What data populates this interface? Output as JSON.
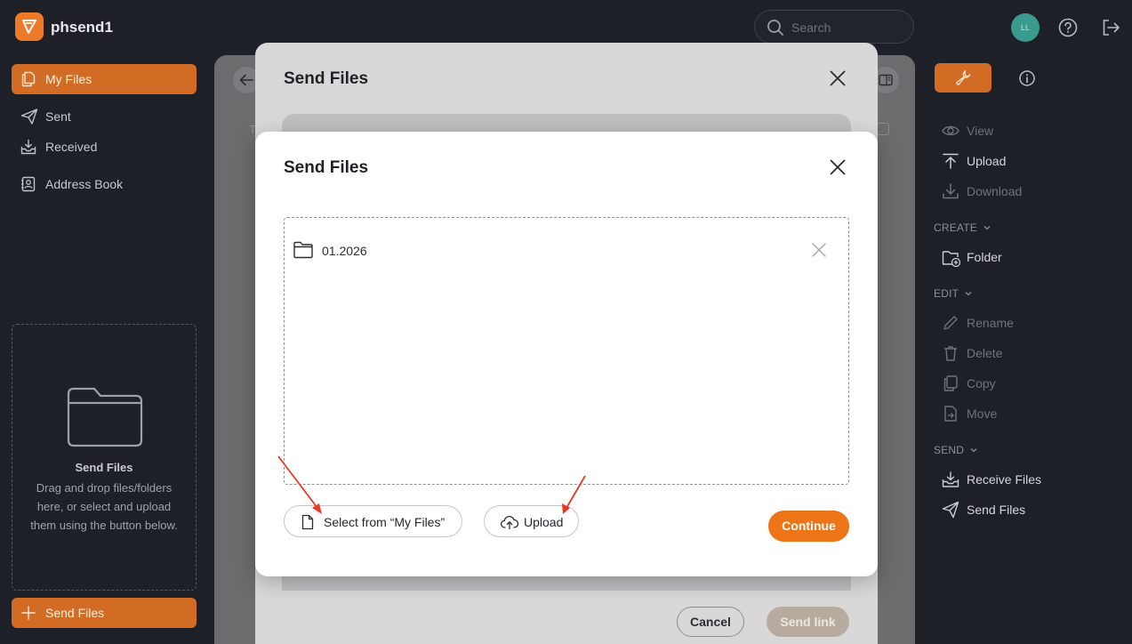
{
  "app": {
    "org_name": "phsend1",
    "avatar_initials": "LL",
    "accent_color": "#ed7417"
  },
  "search": {
    "placeholder": "Search"
  },
  "sidebar": {
    "items": [
      {
        "label": "My Files",
        "icon": "files-icon",
        "active": true
      },
      {
        "label": "Sent",
        "icon": "paper-plane-icon"
      },
      {
        "label": "Received",
        "icon": "inbox-download-icon"
      },
      {
        "label": "Address Book",
        "icon": "address-book-icon"
      }
    ],
    "dropzone": {
      "title": "Send Files",
      "text": "Drag and drop files/folders here, or select and upload them using the button below."
    },
    "send_button": "Send Files"
  },
  "actions": {
    "view": "View",
    "upload": "Upload",
    "download": "Download",
    "create_header": "CREATE",
    "folder": "Folder",
    "edit_header": "EDIT",
    "rename": "Rename",
    "delete": "Delete",
    "copy": "Copy",
    "move": "Move",
    "send_header": "SEND",
    "receive_files": "Receive Files",
    "send_files": "Send Files"
  },
  "main": {
    "column_letter": "T"
  },
  "back_dialog": {
    "title": "Send Files",
    "cancel": "Cancel",
    "send_link": "Send link"
  },
  "dialog": {
    "title": "Send Files",
    "items": [
      {
        "name": "01.2026",
        "icon": "folder-icon"
      }
    ],
    "select_from_my_files": "Select from “My Files”",
    "upload": "Upload",
    "continue": "Continue"
  }
}
